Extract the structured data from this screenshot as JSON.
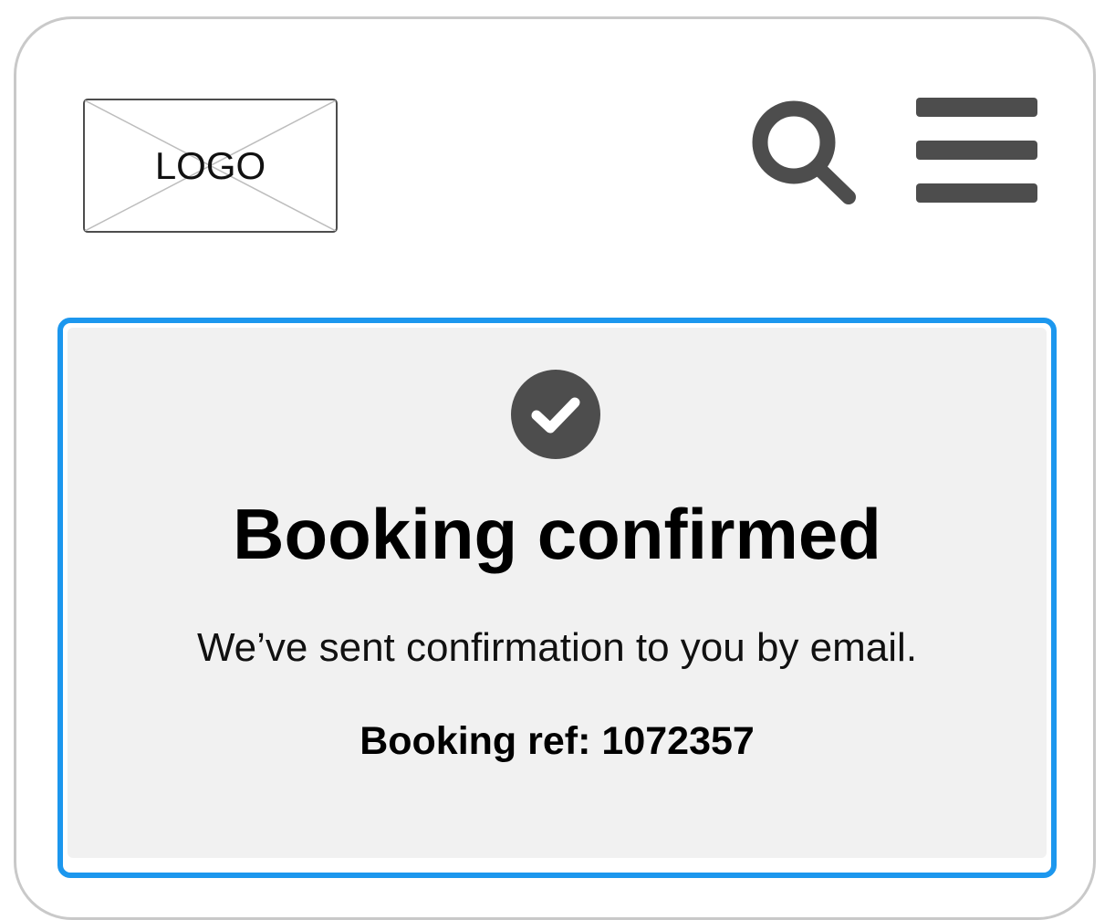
{
  "header": {
    "logo_text": "LOGO",
    "search_icon": "search-icon",
    "menu_icon": "hamburger-menu-icon"
  },
  "confirmation": {
    "status_icon": "check-circle-icon",
    "title": "Booking confirmed",
    "message": "We’ve sent confirmation to you by email.",
    "ref_label": "Booking ref:",
    "ref_value": "1072357"
  },
  "colors": {
    "highlight_border": "#1c97ee",
    "card_background": "#f1f1f1",
    "icon_color": "#4d4d4d"
  }
}
